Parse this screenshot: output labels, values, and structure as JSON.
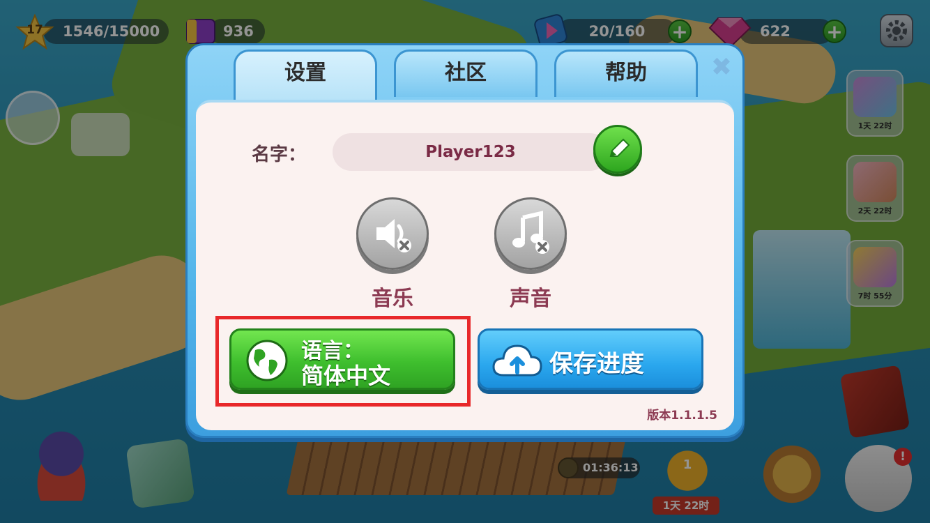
{
  "hud": {
    "level": "17",
    "xp": "1546/15000",
    "coins": "936",
    "energy": "20/160",
    "gems": "622",
    "plus_symbol": "+"
  },
  "side_events": [
    {
      "time": "1天 22时"
    },
    {
      "time": "2天 22时"
    },
    {
      "time": "7时 55分"
    }
  ],
  "bottom": {
    "timer": "01:36:13",
    "trophy_rank": "1",
    "trophy_time": "1天 22时",
    "alert": "!"
  },
  "dialog": {
    "tabs": [
      {
        "label": "设置",
        "active": true
      },
      {
        "label": "社区",
        "active": false
      },
      {
        "label": "帮助",
        "active": false
      }
    ],
    "close_symbol": "✖",
    "name_label": "名字：",
    "player_name": "Player123",
    "music_label": "音乐",
    "sound_label": "声音",
    "language_line1": "语言：",
    "language_line2": "简体中文",
    "save_label": "保存进度",
    "version": "版本1.1.1.5"
  },
  "colors": {
    "highlight": "#e8282a",
    "green_button": "#3fbf2e",
    "blue_button": "#2aa7ee",
    "label_text": "#8c3a52"
  },
  "icons": [
    "star-icon",
    "coin-book-icon",
    "energy-icon",
    "gem-icon",
    "gear-icon",
    "pencil-icon",
    "music-muted-icon",
    "sound-muted-icon",
    "globe-icon",
    "cloud-upload-icon",
    "close-icon"
  ]
}
